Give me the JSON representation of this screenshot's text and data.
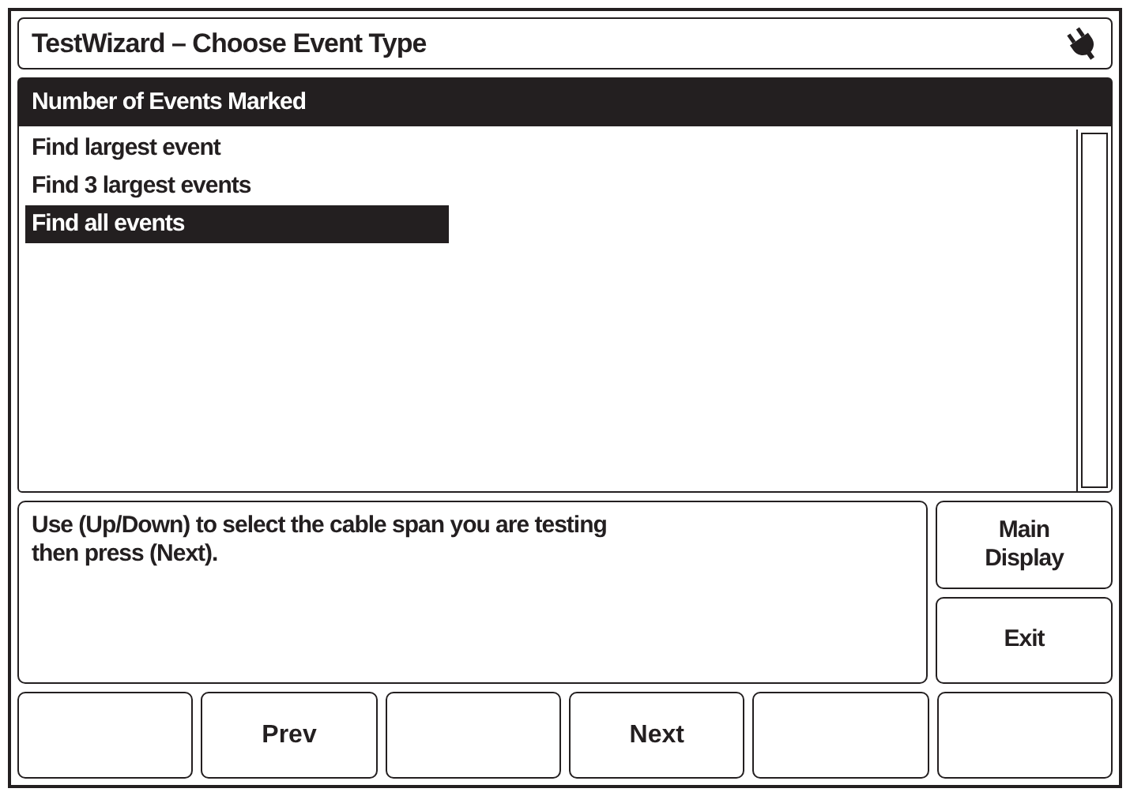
{
  "window": {
    "title": "TestWizard – Choose Event Type"
  },
  "list": {
    "header": "Number of Events Marked",
    "items": [
      {
        "label": "Find largest event",
        "selected": false
      },
      {
        "label": "Find 3 largest events",
        "selected": false
      },
      {
        "label": "Find all events",
        "selected": true
      }
    ]
  },
  "message": "Use (Up/Down) to select the cable span you are testing\nthen press (Next).",
  "side_buttons": [
    {
      "label": "Main\nDisplay"
    },
    {
      "label": "Exit"
    }
  ],
  "function_keys": [
    {
      "kind": "blank"
    },
    {
      "kind": "labeled",
      "label": "Prev"
    },
    {
      "kind": "blank"
    },
    {
      "kind": "labeled",
      "label": "Next"
    },
    {
      "kind": "blank"
    },
    {
      "kind": "blank"
    }
  ]
}
